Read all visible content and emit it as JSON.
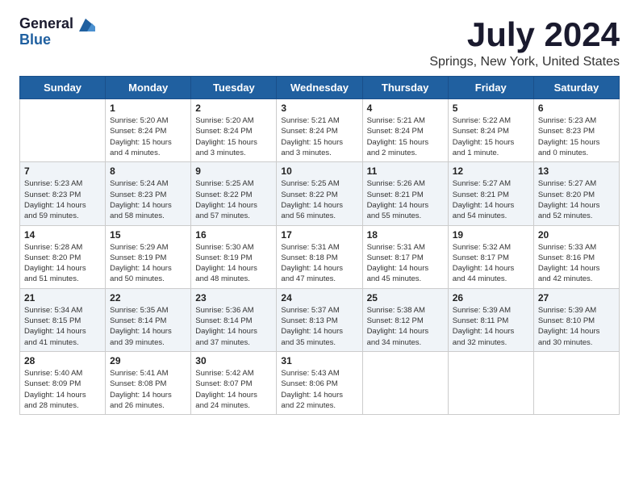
{
  "logo": {
    "general": "General",
    "blue": "Blue"
  },
  "title": "July 2024",
  "location": "Springs, New York, United States",
  "days_of_week": [
    "Sunday",
    "Monday",
    "Tuesday",
    "Wednesday",
    "Thursday",
    "Friday",
    "Saturday"
  ],
  "weeks": [
    {
      "alt": false,
      "days": [
        {
          "number": "",
          "content": ""
        },
        {
          "number": "1",
          "content": "Sunrise: 5:20 AM\nSunset: 8:24 PM\nDaylight: 15 hours\nand 4 minutes."
        },
        {
          "number": "2",
          "content": "Sunrise: 5:20 AM\nSunset: 8:24 PM\nDaylight: 15 hours\nand 3 minutes."
        },
        {
          "number": "3",
          "content": "Sunrise: 5:21 AM\nSunset: 8:24 PM\nDaylight: 15 hours\nand 3 minutes."
        },
        {
          "number": "4",
          "content": "Sunrise: 5:21 AM\nSunset: 8:24 PM\nDaylight: 15 hours\nand 2 minutes."
        },
        {
          "number": "5",
          "content": "Sunrise: 5:22 AM\nSunset: 8:24 PM\nDaylight: 15 hours\nand 1 minute."
        },
        {
          "number": "6",
          "content": "Sunrise: 5:23 AM\nSunset: 8:23 PM\nDaylight: 15 hours\nand 0 minutes."
        }
      ]
    },
    {
      "alt": true,
      "days": [
        {
          "number": "7",
          "content": "Sunrise: 5:23 AM\nSunset: 8:23 PM\nDaylight: 14 hours\nand 59 minutes."
        },
        {
          "number": "8",
          "content": "Sunrise: 5:24 AM\nSunset: 8:23 PM\nDaylight: 14 hours\nand 58 minutes."
        },
        {
          "number": "9",
          "content": "Sunrise: 5:25 AM\nSunset: 8:22 PM\nDaylight: 14 hours\nand 57 minutes."
        },
        {
          "number": "10",
          "content": "Sunrise: 5:25 AM\nSunset: 8:22 PM\nDaylight: 14 hours\nand 56 minutes."
        },
        {
          "number": "11",
          "content": "Sunrise: 5:26 AM\nSunset: 8:21 PM\nDaylight: 14 hours\nand 55 minutes."
        },
        {
          "number": "12",
          "content": "Sunrise: 5:27 AM\nSunset: 8:21 PM\nDaylight: 14 hours\nand 54 minutes."
        },
        {
          "number": "13",
          "content": "Sunrise: 5:27 AM\nSunset: 8:20 PM\nDaylight: 14 hours\nand 52 minutes."
        }
      ]
    },
    {
      "alt": false,
      "days": [
        {
          "number": "14",
          "content": "Sunrise: 5:28 AM\nSunset: 8:20 PM\nDaylight: 14 hours\nand 51 minutes."
        },
        {
          "number": "15",
          "content": "Sunrise: 5:29 AM\nSunset: 8:19 PM\nDaylight: 14 hours\nand 50 minutes."
        },
        {
          "number": "16",
          "content": "Sunrise: 5:30 AM\nSunset: 8:19 PM\nDaylight: 14 hours\nand 48 minutes."
        },
        {
          "number": "17",
          "content": "Sunrise: 5:31 AM\nSunset: 8:18 PM\nDaylight: 14 hours\nand 47 minutes."
        },
        {
          "number": "18",
          "content": "Sunrise: 5:31 AM\nSunset: 8:17 PM\nDaylight: 14 hours\nand 45 minutes."
        },
        {
          "number": "19",
          "content": "Sunrise: 5:32 AM\nSunset: 8:17 PM\nDaylight: 14 hours\nand 44 minutes."
        },
        {
          "number": "20",
          "content": "Sunrise: 5:33 AM\nSunset: 8:16 PM\nDaylight: 14 hours\nand 42 minutes."
        }
      ]
    },
    {
      "alt": true,
      "days": [
        {
          "number": "21",
          "content": "Sunrise: 5:34 AM\nSunset: 8:15 PM\nDaylight: 14 hours\nand 41 minutes."
        },
        {
          "number": "22",
          "content": "Sunrise: 5:35 AM\nSunset: 8:14 PM\nDaylight: 14 hours\nand 39 minutes."
        },
        {
          "number": "23",
          "content": "Sunrise: 5:36 AM\nSunset: 8:14 PM\nDaylight: 14 hours\nand 37 minutes."
        },
        {
          "number": "24",
          "content": "Sunrise: 5:37 AM\nSunset: 8:13 PM\nDaylight: 14 hours\nand 35 minutes."
        },
        {
          "number": "25",
          "content": "Sunrise: 5:38 AM\nSunset: 8:12 PM\nDaylight: 14 hours\nand 34 minutes."
        },
        {
          "number": "26",
          "content": "Sunrise: 5:39 AM\nSunset: 8:11 PM\nDaylight: 14 hours\nand 32 minutes."
        },
        {
          "number": "27",
          "content": "Sunrise: 5:39 AM\nSunset: 8:10 PM\nDaylight: 14 hours\nand 30 minutes."
        }
      ]
    },
    {
      "alt": false,
      "days": [
        {
          "number": "28",
          "content": "Sunrise: 5:40 AM\nSunset: 8:09 PM\nDaylight: 14 hours\nand 28 minutes."
        },
        {
          "number": "29",
          "content": "Sunrise: 5:41 AM\nSunset: 8:08 PM\nDaylight: 14 hours\nand 26 minutes."
        },
        {
          "number": "30",
          "content": "Sunrise: 5:42 AM\nSunset: 8:07 PM\nDaylight: 14 hours\nand 24 minutes."
        },
        {
          "number": "31",
          "content": "Sunrise: 5:43 AM\nSunset: 8:06 PM\nDaylight: 14 hours\nand 22 minutes."
        },
        {
          "number": "",
          "content": ""
        },
        {
          "number": "",
          "content": ""
        },
        {
          "number": "",
          "content": ""
        }
      ]
    }
  ]
}
